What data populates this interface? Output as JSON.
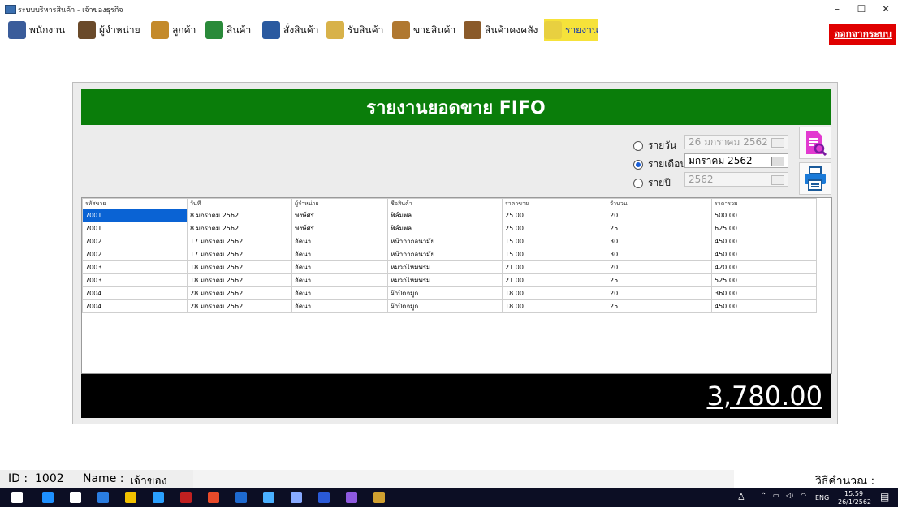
{
  "window": {
    "title": "ระบบบริหารสินค้า - เจ้าของธุรกิจ",
    "minimize": "–",
    "maximize": "☐",
    "close": "✕"
  },
  "menu": [
    {
      "label": "พนักงาน",
      "icon": "employee-icon",
      "color": "#3a5c9a"
    },
    {
      "label": "ผู้จำหน่าย",
      "icon": "supplier-icon",
      "color": "#6a4a2a"
    },
    {
      "label": "ลูกค้า",
      "icon": "customer-icon",
      "color": "#c48a2a"
    },
    {
      "label": "สินค้า",
      "icon": "product-icon",
      "color": "#2a8a3a"
    },
    {
      "label": "สั่งสินค้า",
      "icon": "order-icon",
      "color": "#2a5aa0"
    },
    {
      "label": "รับสินค้า",
      "icon": "receive-icon",
      "color": "#d8b24a"
    },
    {
      "label": "ขายสินค้า",
      "icon": "sell-icon",
      "color": "#b07830"
    },
    {
      "label": "สินค้าคงคลัง",
      "icon": "inventory-icon",
      "color": "#8a5a2a"
    },
    {
      "label": "รายงาน",
      "icon": "report-icon",
      "color": "#e8d040"
    }
  ],
  "logout_label": "ออกจากระบบ",
  "report": {
    "title": "รายงานยอดขาย FIFO",
    "filters": {
      "daily": {
        "label": "รายวัน",
        "value": "26  มกราคม    2562",
        "selected": false
      },
      "monthly": {
        "label": "รายเดือน",
        "value": "มกราคม    2562",
        "selected": true
      },
      "yearly": {
        "label": "รายปี",
        "value": "2562",
        "selected": false
      }
    },
    "columns": [
      "รหัสขาย",
      "วันที่",
      "ผู้จำหน่าย",
      "ชื่อสินค้า",
      "ราคาขาย",
      "จำนวน",
      "ราคารวม"
    ],
    "rows": [
      [
        "7001",
        "8 มกราคม 2562",
        "พงษ์ศร",
        "ฟิล์มพล",
        "25.00",
        "20",
        "500.00"
      ],
      [
        "7001",
        "8 มกราคม 2562",
        "พงษ์ศร",
        "ฟิล์มพล",
        "25.00",
        "25",
        "625.00"
      ],
      [
        "7002",
        "17 มกราคม 2562",
        "อัคนา",
        "หน้ากากอนามัย",
        "15.00",
        "30",
        "450.00"
      ],
      [
        "7002",
        "17 มกราคม 2562",
        "อัคนา",
        "หน้ากากอนามัย",
        "15.00",
        "30",
        "450.00"
      ],
      [
        "7003",
        "18 มกราคม 2562",
        "อัคนา",
        "หมวกไหมพรม",
        "21.00",
        "20",
        "420.00"
      ],
      [
        "7003",
        "18 มกราคม 2562",
        "อัคนา",
        "หมวกไหมพรม",
        "21.00",
        "25",
        "525.00"
      ],
      [
        "7004",
        "28 มกราคม 2562",
        "อัคนา",
        "ผ้าปิดจมูก",
        "18.00",
        "20",
        "360.00"
      ],
      [
        "7004",
        "28 มกราคม 2562",
        "อัคนา",
        "ผ้าปิดจมูก",
        "18.00",
        "25",
        "450.00"
      ]
    ],
    "total": "3,780.00"
  },
  "status": {
    "id_label": "ID :",
    "id_value": "1002",
    "name_label": "Name :",
    "name_value": "เจ้าของธุรกิจ",
    "method": "วิธีคำนวณ : FIFO"
  },
  "taskbar": {
    "lang": "ENG",
    "time": "15:59",
    "date": "26/1/2562",
    "apps": [
      "#1e90ff",
      "#ffffff",
      "#2a7de1",
      "#f2c200",
      "#2aa0ff",
      "#c02020",
      "#e84a2a",
      "#1e6ad0",
      "#4ab0ff",
      "#88aaff",
      "#2a5ad8",
      "#8e5ae0",
      "#d0a030"
    ]
  }
}
